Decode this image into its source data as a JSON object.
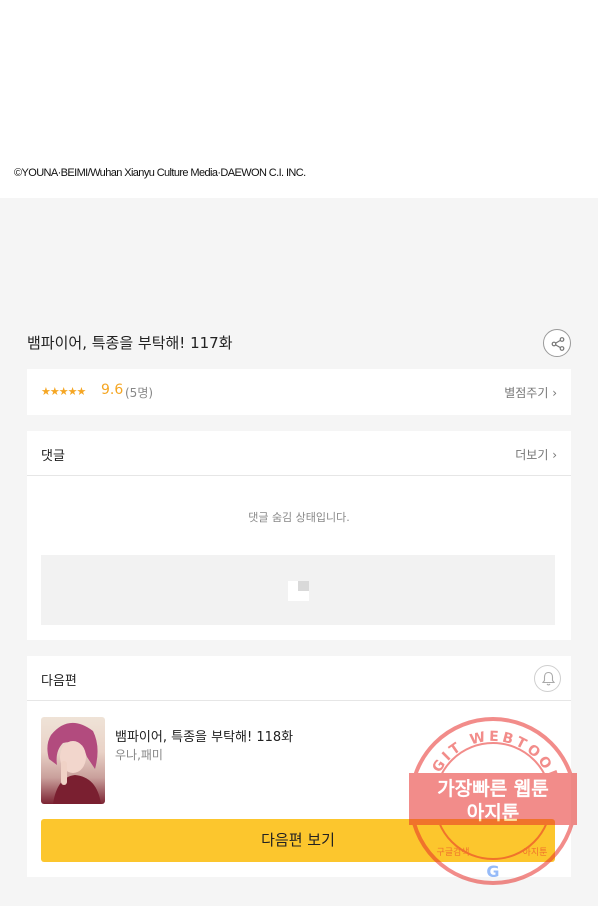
{
  "copyright": "©YOUNA·BEIMI/Wuhan Xianyu Culture Media·DAEWON C.I. INC.",
  "episode": {
    "title": "뱀파이어, 특종을 부탁해! 117화"
  },
  "rating": {
    "stars": "★★★★★",
    "score": "9.6",
    "count": "(5명)",
    "rate_link": "별점주기 ›"
  },
  "comments": {
    "title": "댓글",
    "more_link": "더보기 ›",
    "hidden_message": "댓글 숨김 상태입니다."
  },
  "next": {
    "title": "다음편",
    "episode_title": "뱀파이어, 특종을 부탁해! 118화",
    "author": "우나,패미",
    "button_label": "다음편 보기"
  },
  "watermark": {
    "ring_text": "AGIT WEBTOON",
    "line1": "가장빠른 웹툰",
    "line2": "아지툰",
    "left_small": "구글검색",
    "right_small": "아지툰"
  },
  "colors": {
    "accent": "#fcc62d",
    "star": "#f5a623",
    "watermark": "#e8302b"
  }
}
